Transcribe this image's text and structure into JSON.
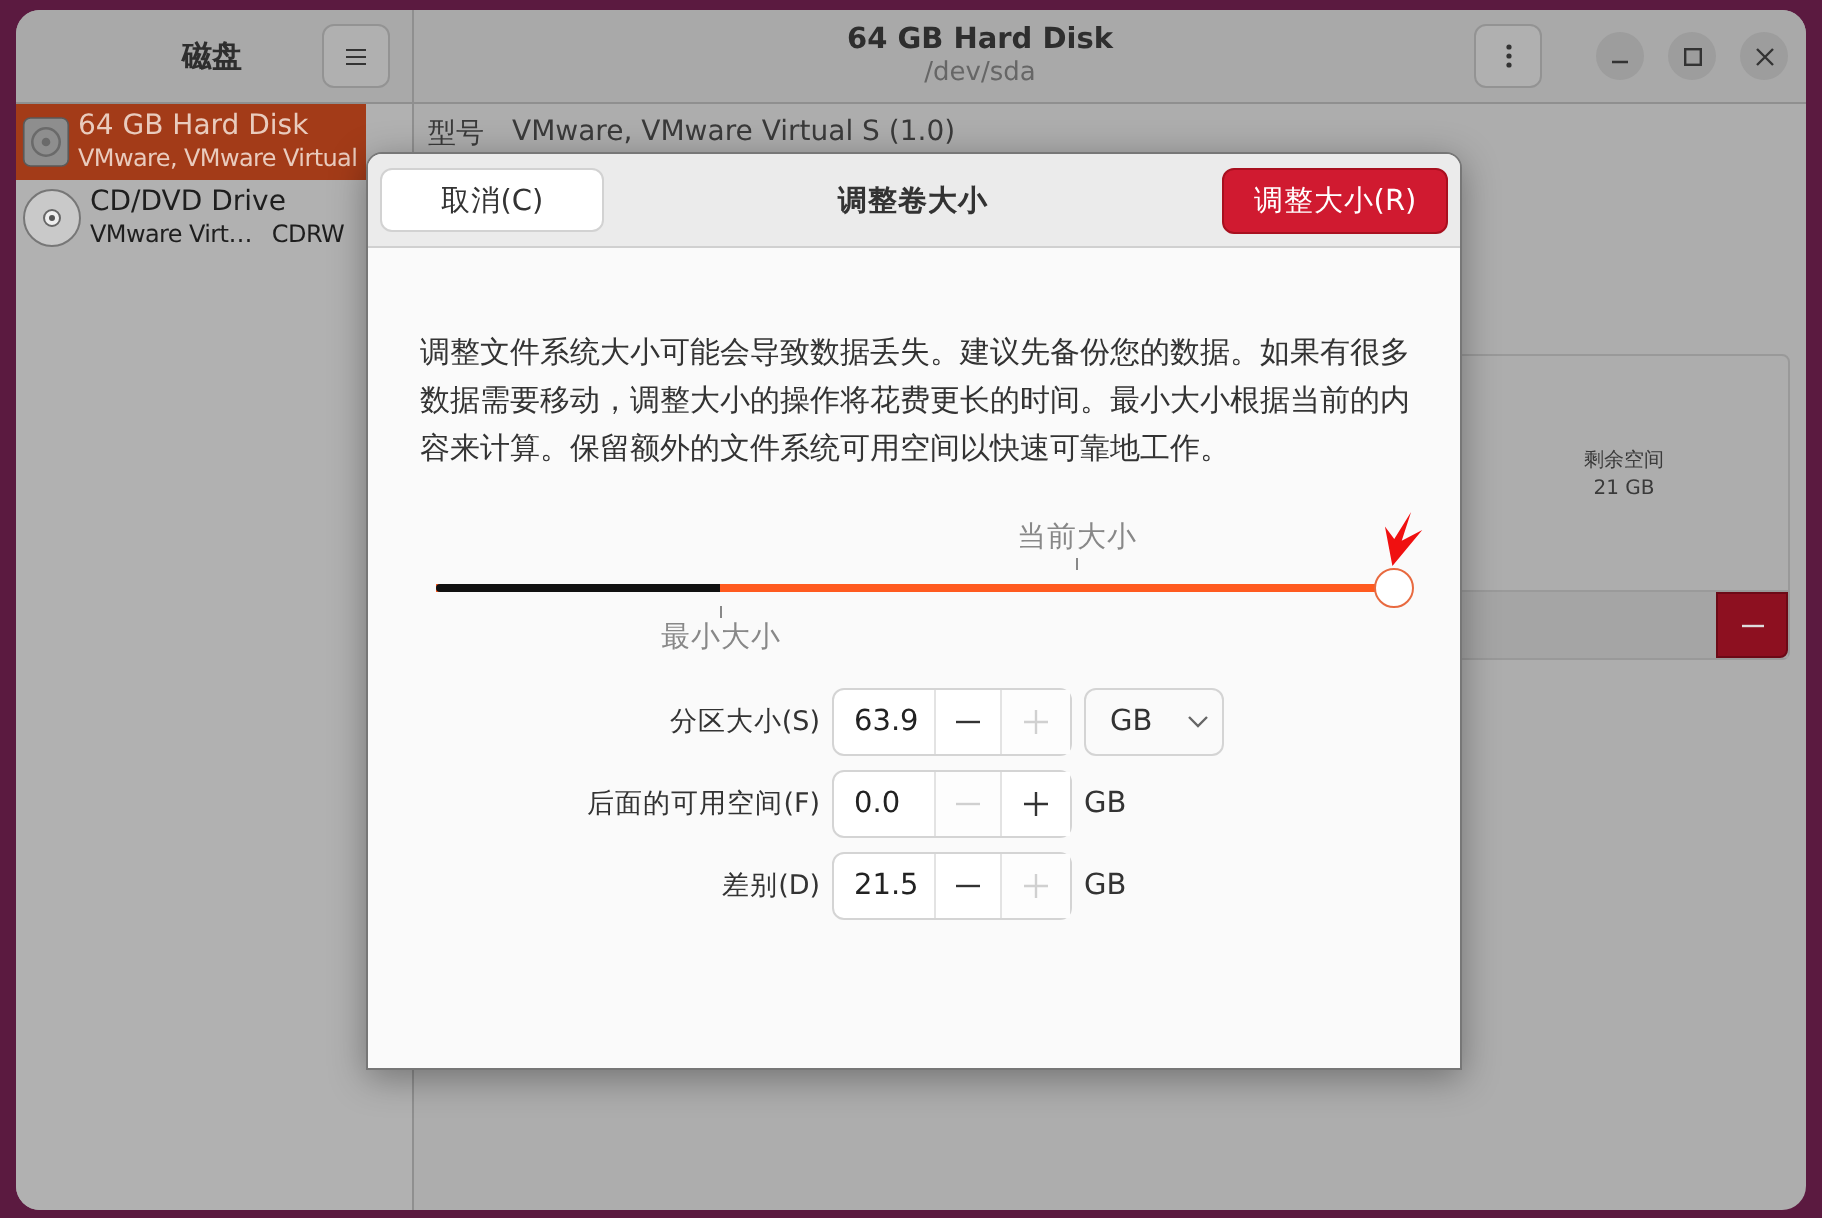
{
  "window": {
    "title": "64 GB Hard Disk",
    "subtitle": "/dev/sda"
  },
  "sidebar": {
    "title": "磁盘",
    "items": [
      {
        "kind": "harddisk",
        "name": "64 GB Hard Disk",
        "details": [
          "VMware, VMware Virtual"
        ],
        "selected": true
      },
      {
        "kind": "optical",
        "name": "CD/DVD Drive",
        "details": [
          "VMware Virt…",
          "CDRW"
        ],
        "selected": false
      }
    ]
  },
  "content": {
    "model_label": "型号",
    "model_value": "VMware, VMware Virtual S (1.0)",
    "partition": {
      "label": "剩余空间",
      "size": "21 GB"
    }
  },
  "dialog": {
    "title": "调整卷大小",
    "cancel": "取消(C)",
    "confirm": "调整大小(R)",
    "message": "调整文件系统大小可能会导致数据丢失。建议先备份您的数据。如果有很多数据需要移动，调整大小的操作将花费更长的时间。最小大小根据当前的内容来计算。保留额外的文件系统可用空间以快速可靠地工作。",
    "slider": {
      "level": 1,
      "current_label": "当前大小",
      "min_label": "最小大小"
    },
    "fields": [
      {
        "label": "分区大小(S)",
        "value": "63.9",
        "decrease_disabled": false,
        "increase_disabled": true,
        "kind": "dropdown",
        "unit": "GB"
      },
      {
        "label": "后面的可用空间(F)",
        "value": "0.0",
        "decrease_disabled": true,
        "increase_disabled": false,
        "kind": "text",
        "unit": "GB"
      },
      {
        "label": "差别(D)",
        "value": "21.5",
        "decrease_disabled": false,
        "increase_disabled": true,
        "kind": "text",
        "unit": "GB"
      }
    ]
  }
}
